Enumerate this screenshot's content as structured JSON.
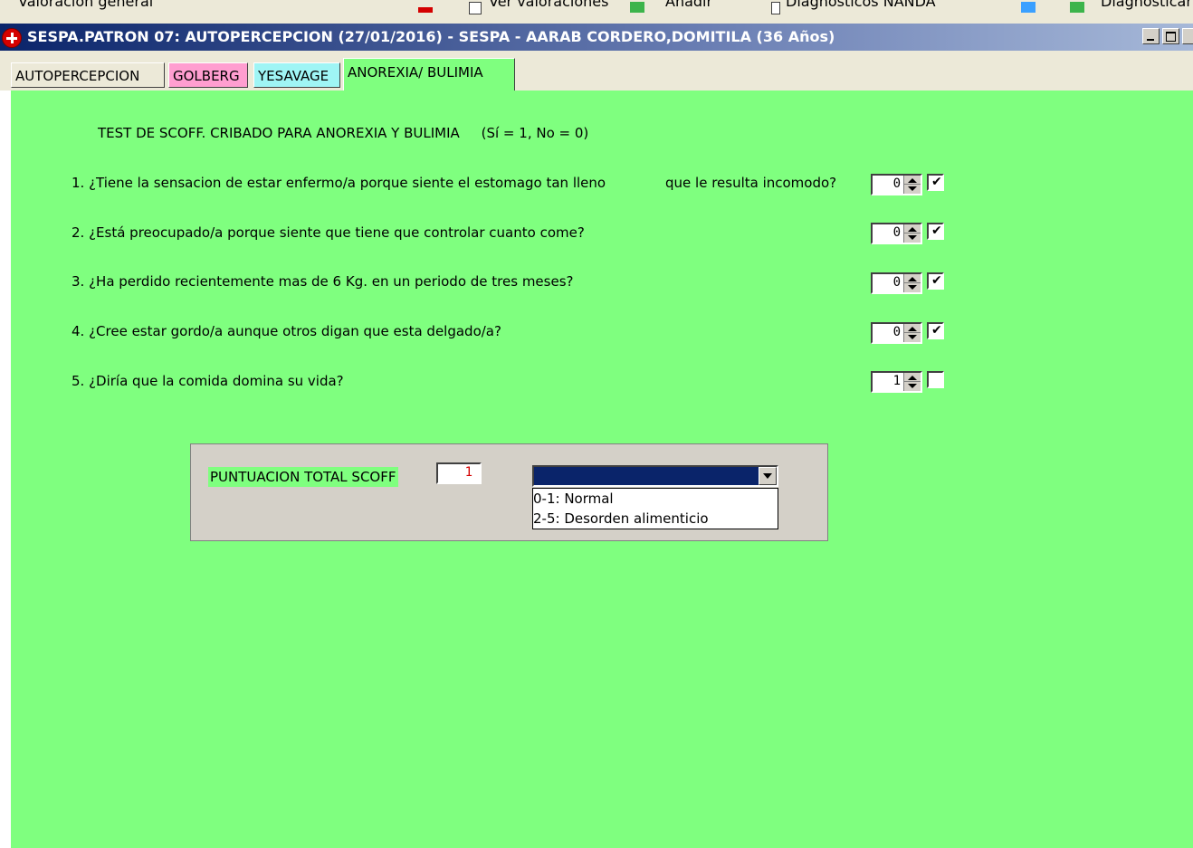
{
  "toolbar": {
    "items": [
      "Valoración general",
      "Ver valoraciones",
      "Añadir",
      "Diagnósticos NANDA",
      "Diagnosticar"
    ]
  },
  "window": {
    "title": "SESPA.PATRON 07: AUTOPERCEPCION (27/01/2016) - SESPA - AARAB CORDERO,DOMITILA (36 Años)"
  },
  "tabs": [
    {
      "label": "AUTOPERCEPCION"
    },
    {
      "label": "GOLBERG"
    },
    {
      "label": "YESAVAGE"
    },
    {
      "label": "ANOREXIA/ BULIMIA",
      "active": true
    }
  ],
  "form": {
    "title": "TEST DE SCOFF. CRIBADO PARA ANOREXIA Y BULIMIA     (Sí = 1, No = 0)",
    "questions": [
      {
        "text": "1. ¿Tiene la sensacion de estar enfermo/a porque siente el estomago tan lleno",
        "text_extra": "que le resulta incomodo?",
        "value": "0",
        "checked": true
      },
      {
        "text": "2. ¿Está preocupado/a porque siente que tiene que controlar cuanto come?",
        "text_extra": "",
        "value": "0",
        "checked": true
      },
      {
        "text": "3. ¿Ha perdido recientemente mas de 6 Kg. en un periodo de tres meses?",
        "text_extra": "",
        "value": "0",
        "checked": true
      },
      {
        "text": "4. ¿Cree estar gordo/a aunque otros digan que esta delgado/a?",
        "text_extra": "",
        "value": "0",
        "checked": true
      },
      {
        "text": "5. ¿Diría que la comida domina su vida?",
        "text_extra": "",
        "value": "1",
        "checked": false
      }
    ],
    "total": {
      "label": "PUNTUACION TOTAL SCOFF",
      "value": "1",
      "combo_selected": "",
      "options": [
        "0-1: Normal",
        "2-5: Desorden alimenticio"
      ]
    }
  },
  "colors": {
    "form_bg": "#7fff7f",
    "golberg_tab": "#ff9ed0",
    "yesavage_tab": "#9ff5f5",
    "titlebar": "#0a246a",
    "total_value": "#d40000"
  }
}
